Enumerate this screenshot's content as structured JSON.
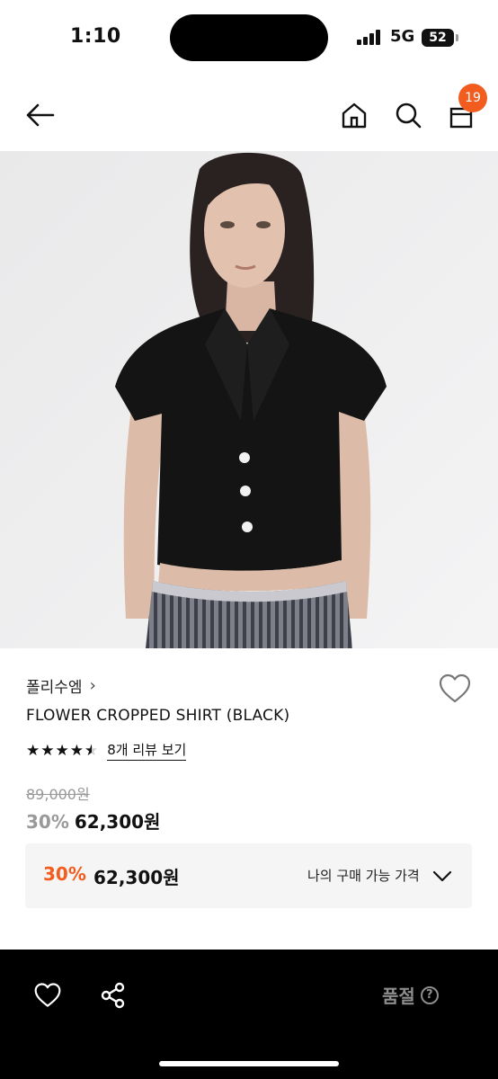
{
  "status": {
    "time": "1:10",
    "network": "5G",
    "battery": "52"
  },
  "nav": {
    "cart_count": "19"
  },
  "product": {
    "brand": "폴리수엠",
    "brand_chevron": "›",
    "name": "FLOWER CROPPED SHIRT (BLACK)",
    "rating": 4.5,
    "stars": [
      "★",
      "★",
      "★",
      "★",
      "★"
    ],
    "review_link": "8개 리뷰 보기",
    "original_price": "89,000원",
    "discount": "30%",
    "price": "62,300원"
  },
  "buy_box": {
    "discount": "30%",
    "price": "62,300원",
    "label": "나의 구매 가능 가격"
  },
  "bottom": {
    "soldout_label": "품절",
    "help": "?"
  },
  "colors": {
    "accent": "#f25c1e",
    "muted": "#999999",
    "bottom_bar": "#000000"
  }
}
